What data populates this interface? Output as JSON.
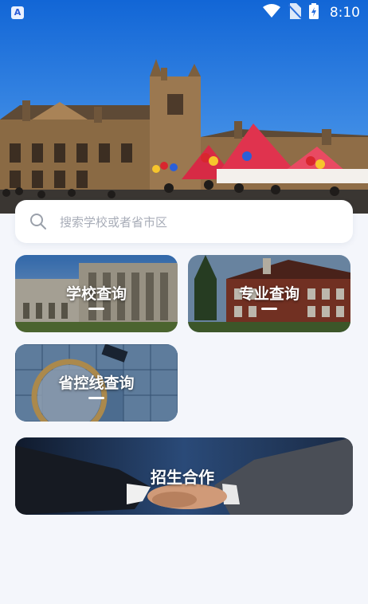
{
  "status_bar": {
    "app_badge": "A",
    "time": "8:10",
    "icons": [
      "wifi-icon",
      "no-sim-icon",
      "battery-charging-icon"
    ]
  },
  "hero": {
    "image": "university-campus-banner"
  },
  "search": {
    "placeholder": "搜索学校或者省市区",
    "value": "",
    "icon": "search-icon"
  },
  "cards": [
    {
      "label": "学校查询",
      "image": "campus-building"
    },
    {
      "label": "专业查询",
      "image": "brick-college-building"
    },
    {
      "label": "省控线查询",
      "image": "puzzle-magnifier"
    }
  ],
  "banner": {
    "label": "招生合作",
    "image": "handshake"
  },
  "colors": {
    "background": "#f4f6fb",
    "card_text": "#ffffff",
    "placeholder": "#a8adb8"
  }
}
